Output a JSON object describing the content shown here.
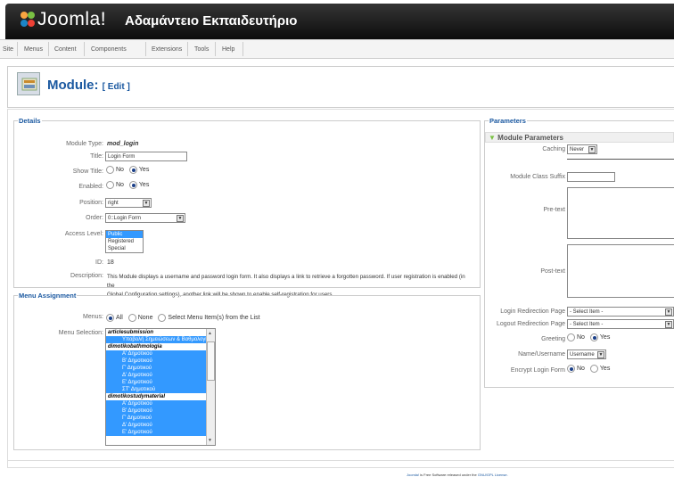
{
  "header": {
    "logo_text": "Joomla!",
    "site_name": "Αδαμάντειο Εκπαιδευτήριο"
  },
  "menu": [
    "Site",
    "Menus",
    "Content",
    "Components",
    "Extensions",
    "Tools",
    "Help"
  ],
  "page": {
    "title": "Module:",
    "subtitle": "[ Edit ]"
  },
  "details": {
    "legend": "Details",
    "module_type_label": "Module Type:",
    "module_type": "mod_login",
    "title_label": "Title:",
    "title_value": "Login Form",
    "show_title_label": "Show Title:",
    "enabled_label": "Enabled:",
    "no": "No",
    "yes": "Yes",
    "position_label": "Position:",
    "position_value": "right",
    "order_label": "Order:",
    "order_value": "0::Login Form",
    "access_label": "Access Level:",
    "access_options": [
      "Public",
      "Registered",
      "Special"
    ],
    "id_label": "ID:",
    "id_value": "18",
    "description_label": "Description:",
    "description_line1": "This Module displays a username and password login form. It also displays a link to retrieve a forgotten password. If user registration is enabled (in the",
    "description_line2": "Global Configuration settings), another link will be shown to enable self-registration for users."
  },
  "menu_assignment": {
    "legend": "Menu Assignment",
    "menus_label": "Menus:",
    "all": "All",
    "none": "None",
    "select": "Select Menu Item(s) from the List",
    "selection_label": "Menu Selection:",
    "items": [
      {
        "text": "articlesubmission",
        "type": "grp"
      },
      {
        "text": "Υποβολή Σημειώσεων & Βαθμολογιών",
        "type": "sel"
      },
      {
        "text": "dimotikobathmologia",
        "type": "grp"
      },
      {
        "text": "Α' Δημοτικού",
        "type": "sel"
      },
      {
        "text": "Β' Δημοτικού",
        "type": "sel"
      },
      {
        "text": "Γ' Δημοτικού",
        "type": "sel"
      },
      {
        "text": "Δ' Δημοτικού",
        "type": "sel"
      },
      {
        "text": "Ε' Δημοτικού",
        "type": "sel"
      },
      {
        "text": "ΣΤ' Δημοτικού",
        "type": "sel"
      },
      {
        "text": "dimotikostudymaterial",
        "type": "grp"
      },
      {
        "text": "Α' Δημοτικού",
        "type": "sel"
      },
      {
        "text": "Β' Δημοτικού",
        "type": "sel"
      },
      {
        "text": "Γ' Δημοτικού",
        "type": "sel"
      },
      {
        "text": "Δ' Δημοτικού",
        "type": "sel"
      },
      {
        "text": "Ε' Δημοτικού",
        "type": "sel"
      }
    ]
  },
  "parameters": {
    "legend": "Parameters",
    "section": "Module Parameters",
    "caching_label": "Caching",
    "caching_value": "Never",
    "suffix_label": "Module Class Suffix",
    "pretext_label": "Pre-text",
    "posttext_label": "Post-text",
    "login_redirect_label": "Login Redirection Page",
    "login_redirect_value": "- Select Item -",
    "logout_redirect_label": "Logout Redirection Page",
    "logout_redirect_value": "- Select Item -",
    "greeting_label": "Greeting",
    "name_label": "Name/Username",
    "name_value": "Username",
    "encrypt_label": "Encrypt Login Form",
    "no": "No",
    "yes": "Yes"
  },
  "footer": {
    "link": "Joomla!",
    "text": " is Free Software released under the ",
    "license": "GNU/GPL License."
  }
}
